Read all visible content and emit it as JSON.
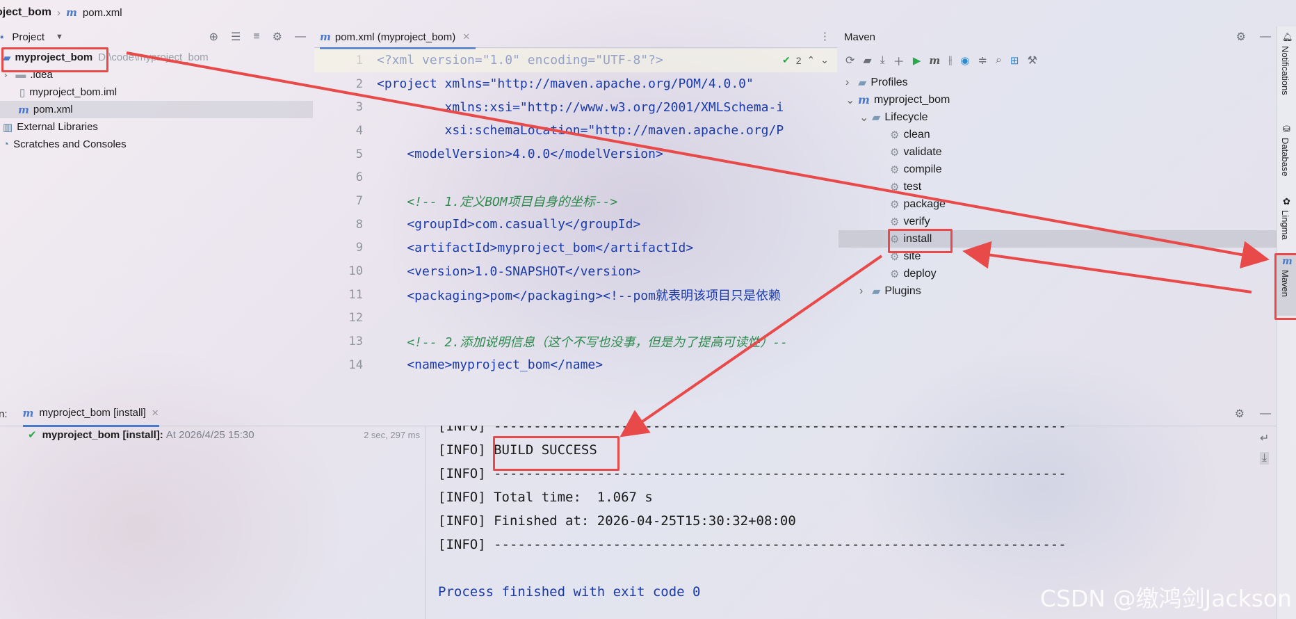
{
  "breadcrumb": {
    "project": "oject_bom",
    "file": "pom.xml"
  },
  "project_panel": {
    "title": "Project",
    "tree": [
      {
        "label": "myproject_bom",
        "path": "D:\\code\\myproject_bom",
        "icon": "module-folder-icon"
      },
      {
        "label": ".idea",
        "icon": "folder-icon"
      },
      {
        "label": "myproject_bom.iml",
        "icon": "iml-file-icon"
      },
      {
        "label": "pom.xml",
        "icon": "maven-file-icon"
      },
      {
        "label": "External Libraries",
        "icon": "libraries-icon"
      },
      {
        "label": "Scratches and Consoles",
        "icon": "scratches-icon"
      }
    ]
  },
  "editor": {
    "tab_label": "pom.xml (myproject_bom)",
    "inspection_count": "2",
    "line_numbers": [
      "1",
      "2",
      "3",
      "4",
      "5",
      "6",
      "7",
      "8",
      "9",
      "10",
      "11",
      "12",
      "13",
      "14"
    ],
    "lines": [
      "<?xml version=\"1.0\" encoding=\"UTF-8\"?>",
      "<project xmlns=\"http://maven.apache.org/POM/4.0.0\"",
      "         xmlns:xsi=\"http://www.w3.org/2001/XMLSchema-i",
      "         xsi:schemaLocation=\"http://maven.apache.org/P",
      "    <modelVersion>4.0.0</modelVersion>",
      "",
      "    <!-- 1.定义BOM项目自身的坐标-->",
      "    <groupId>com.casually</groupId>",
      "    <artifactId>myproject_bom</artifactId>",
      "    <version>1.0-SNAPSHOT</version>",
      "    <packaging>pom</packaging><!--pom就表明该项目只是依赖",
      "",
      "    <!-- 2.添加说明信息（这个不写也没事，但是为了提高可读性）--",
      "    <name>myproject_bom</name>"
    ]
  },
  "maven_panel": {
    "title": "Maven",
    "tree": {
      "profiles": "Profiles",
      "project": "myproject_bom",
      "lifecycle": "Lifecycle",
      "phases": [
        "clean",
        "validate",
        "compile",
        "test",
        "package",
        "verify",
        "install",
        "site",
        "deploy"
      ],
      "plugins": "Plugins"
    }
  },
  "right_strip": [
    "Notifications",
    "Database",
    "Lingma",
    "Maven"
  ],
  "run_panel": {
    "prefix": "n:",
    "tab_label": "myproject_bom [install]",
    "entry_name": "myproject_bom [install]:",
    "entry_time": "At 2026/4/25 15:30",
    "duration": "2 sec, 297 ms",
    "console": [
      "[INFO] ------------------------------------------------------------------------",
      "[INFO] BUILD SUCCESS",
      "[INFO] ------------------------------------------------------------------------",
      "[INFO] Total time:  1.067 s",
      "[INFO] Finished at: 2026-04-25T15:30:32+08:00",
      "[INFO] ------------------------------------------------------------------------",
      "",
      "Process finished with exit code 0"
    ]
  },
  "watermark": "CSDN @缴鸿剑Jackson",
  "colors": {
    "highlight": "#e84a4a",
    "maven_accent": "#4a79c9",
    "run_green": "#2aa84a"
  }
}
